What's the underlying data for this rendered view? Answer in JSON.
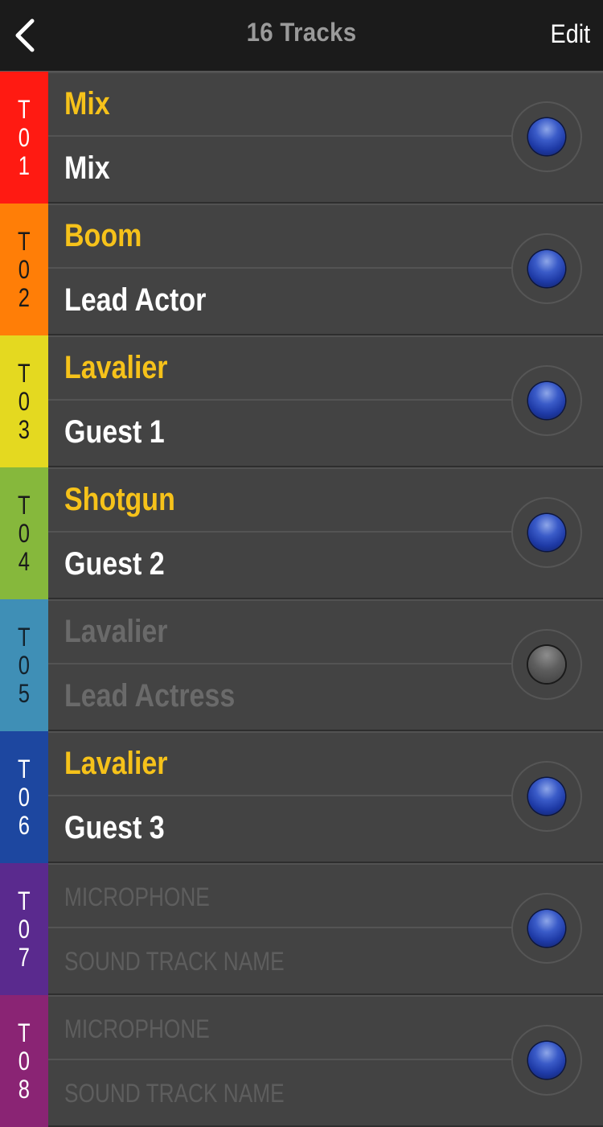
{
  "navbar": {
    "back_icon": "chevron-left-icon",
    "title": "16 Tracks",
    "edit_label": "Edit"
  },
  "colors": {
    "accent_yellow": "#f6c21a",
    "navbar_bg": "#1b1b1b",
    "row_bg": "#434343",
    "knob_on": "#2a4cc0",
    "knob_off": "#6a6a6a"
  },
  "tracks": [
    {
      "id": "T01",
      "chars": [
        "T",
        "0",
        "1"
      ],
      "color": "#ff1a12",
      "label_color": "#ffffff",
      "mic": "Mix",
      "name": "Mix",
      "enabled": true,
      "placeholder": false
    },
    {
      "id": "T02",
      "chars": [
        "T",
        "0",
        "2"
      ],
      "color": "#ff7e07",
      "label_color": "#1a1a1a",
      "mic": "Boom",
      "name": "Lead Actor",
      "enabled": true,
      "placeholder": false
    },
    {
      "id": "T03",
      "chars": [
        "T",
        "0",
        "3"
      ],
      "color": "#e4d920",
      "label_color": "#1a1a1a",
      "mic": "Lavalier",
      "name": "Guest 1",
      "enabled": true,
      "placeholder": false
    },
    {
      "id": "T04",
      "chars": [
        "T",
        "0",
        "4"
      ],
      "color": "#86b83c",
      "label_color": "#1a1a1a",
      "mic": "Shotgun",
      "name": "Guest 2",
      "enabled": true,
      "placeholder": false
    },
    {
      "id": "T05",
      "chars": [
        "T",
        "0",
        "5"
      ],
      "color": "#3f8fb6",
      "label_color": "#14222c",
      "mic": "Lavalier",
      "name": "Lead Actress",
      "enabled": false,
      "placeholder": false
    },
    {
      "id": "T06",
      "chars": [
        "T",
        "0",
        "6"
      ],
      "color": "#1d47a0",
      "label_color": "#ffffff",
      "mic": "Lavalier",
      "name": "Guest 3",
      "enabled": true,
      "placeholder": false
    },
    {
      "id": "T07",
      "chars": [
        "T",
        "0",
        "7"
      ],
      "color": "#5a2a8e",
      "label_color": "#ffffff",
      "mic": "MICROPHONE",
      "name": "SOUND TRACK NAME",
      "enabled": true,
      "placeholder": true
    },
    {
      "id": "T08",
      "chars": [
        "T",
        "0",
        "8"
      ],
      "color": "#8a2474",
      "label_color": "#ffffff",
      "mic": "MICROPHONE",
      "name": "SOUND TRACK NAME",
      "enabled": true,
      "placeholder": true
    }
  ]
}
